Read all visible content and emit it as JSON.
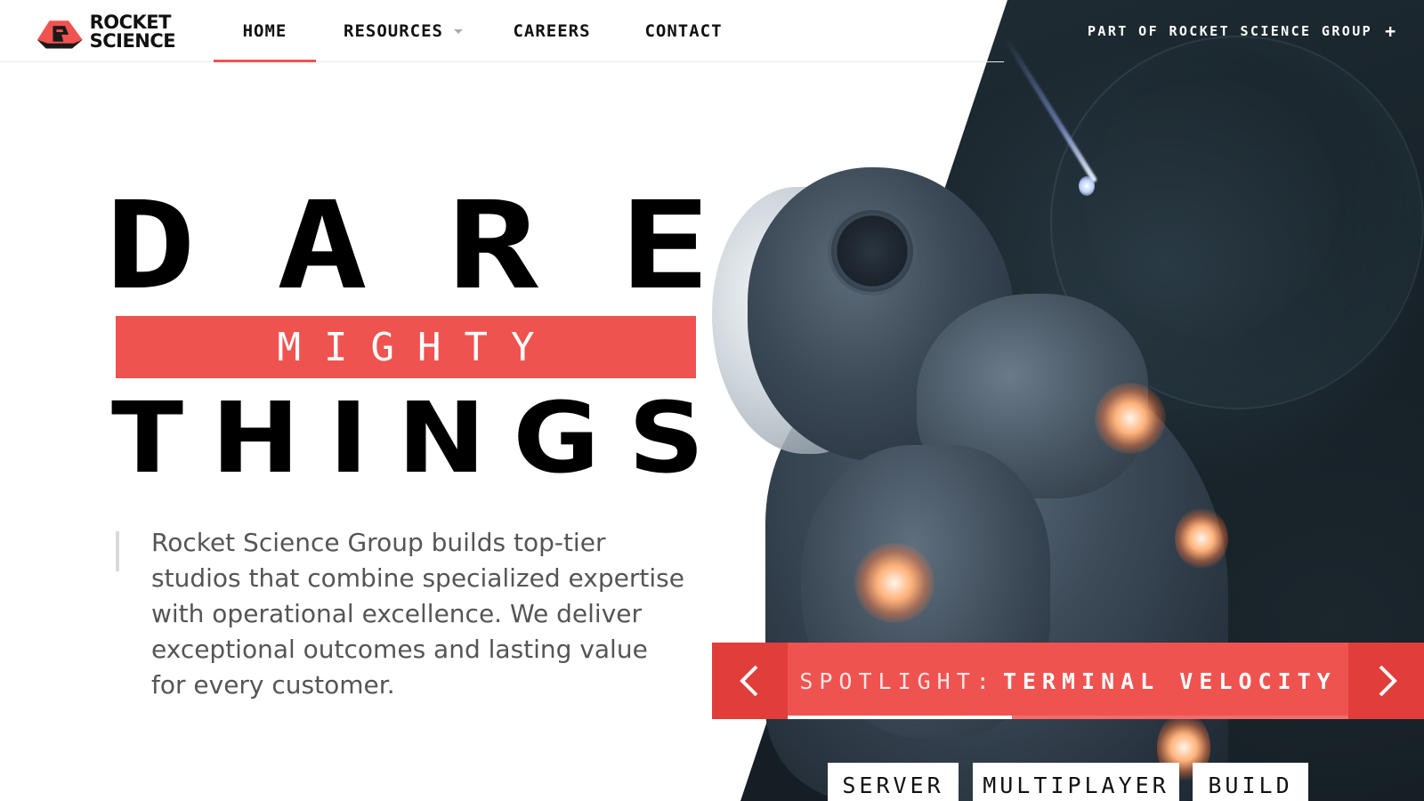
{
  "brand": {
    "logo_line1": "ROCKET",
    "logo_line2": "SCIENCE",
    "accent_color": "#ef5350",
    "accent_dark": "#e13d3a"
  },
  "nav": {
    "items": [
      {
        "label": "HOME",
        "active": true
      },
      {
        "label": "RESOURCES",
        "has_dropdown": true
      },
      {
        "label": "CAREERS"
      },
      {
        "label": "CONTACT"
      }
    ],
    "group_link": "PART OF ROCKET SCIENCE GROUP",
    "group_icon": "plus-icon"
  },
  "hero": {
    "line1": [
      "D",
      "A",
      "R",
      "E"
    ],
    "line2": "MIGHTY",
    "line3": [
      "T",
      "H",
      "I",
      "N",
      "G",
      "S"
    ],
    "description": "Rocket Science Group builds top-tier studios that combine specialized expertise with operational excellence. We deliver exceptional outcomes and lasting value for every customer."
  },
  "spotlight": {
    "prefix": "SPOTLIGHT:",
    "title": "TERMINAL VELOCITY",
    "prev_icon": "chevron-left-icon",
    "next_icon": "chevron-right-icon",
    "progress": 0.4
  },
  "tags": [
    "SERVER",
    "MULTIPLAYER",
    "BUILD"
  ]
}
